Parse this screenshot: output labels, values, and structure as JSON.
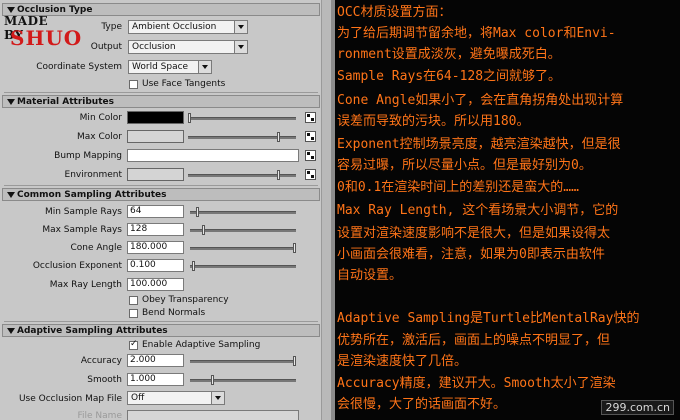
{
  "watermark": {
    "line1": "MADE BY",
    "line2": "SHUO"
  },
  "occlusion_type": {
    "title": "Occlusion Type",
    "type_label": "Type",
    "type_value": "Ambient Occlusion",
    "output_label": "Output",
    "output_value": "Occlusion",
    "coord_label": "Coordinate System",
    "coord_value": "World Space",
    "face_tangents_label": "Use Face Tangents",
    "face_tangents_checked": false
  },
  "material": {
    "title": "Material Attributes",
    "min_color_label": "Min Color",
    "min_color": "#000000",
    "min_color_level": 0.0,
    "max_color_label": "Max Color",
    "max_color": "#d4d4d4",
    "max_color_level": 0.85,
    "bump_label": "Bump Mapping",
    "bump_value": "",
    "env_label": "Environment",
    "env_color": "#d4d4d4",
    "env_level": 0.85
  },
  "sampling": {
    "title": "Common Sampling Attributes",
    "min_rays_label": "Min Sample Rays",
    "min_rays_value": "64",
    "min_rays_level": 0.06,
    "max_rays_label": "Max Sample Rays",
    "max_rays_value": "128",
    "max_rays_level": 0.12,
    "cone_label": "Cone Angle",
    "cone_value": "180.000",
    "cone_level": 1.0,
    "exponent_label": "Occlusion Exponent",
    "exponent_value": "0.100",
    "exponent_level": 0.02,
    "maxray_label": "Max Ray Length",
    "maxray_value": "100.000",
    "obey_label": "Obey Transparency",
    "obey_checked": false,
    "bend_label": "Bend Normals",
    "bend_checked": false
  },
  "adaptive": {
    "title": "Adaptive Sampling Attributes",
    "enable_label": "Enable Adaptive Sampling",
    "enable_checked": true,
    "accuracy_label": "Accuracy",
    "accuracy_value": "2.000",
    "accuracy_level": 1.0,
    "smooth_label": "Smooth",
    "smooth_value": "1.000",
    "smooth_level": 0.2,
    "mapfile_label": "Use Occlusion Map File",
    "mapfile_value": "Off",
    "filename_label": "File Name"
  },
  "notes": [
    "OCC材质设置方面：",
    "为了给后期调节留余地，将Max color和Envi-",
    "ronment设置成淡灰，避免曝成死白。",
    "Sample Rays在64-128之间就够了。",
    "Cone Angle如果小了，会在直角拐角处出现计算",
    "误差而导致的污块。所以用180。",
    "Exponent控制场景亮度，越亮渲染越快，但是很",
    "容易过曝，所以尽量小点。但是最好别为0。",
    "0和0.1在渲染时间上的差别还是蛮大的……",
    "Max Ray Length, 这个看场景大小调节，它的",
    "设置对渲染速度影响不是很大，但是如果设得太",
    "小画面会很难看，注意，如果为0即表示由软件",
    "自动设置。",
    "",
    "Adaptive Sampling是Turtle比MentalRay快的",
    "优势所在，激活后，画面上的噪点不明显了，但",
    "是渲染速度快了几倍。",
    "Accuracy精度，建议开大。Smooth太小了渲染",
    "会很慢，大了的话画面不好。"
  ],
  "site": "299.com.cn"
}
